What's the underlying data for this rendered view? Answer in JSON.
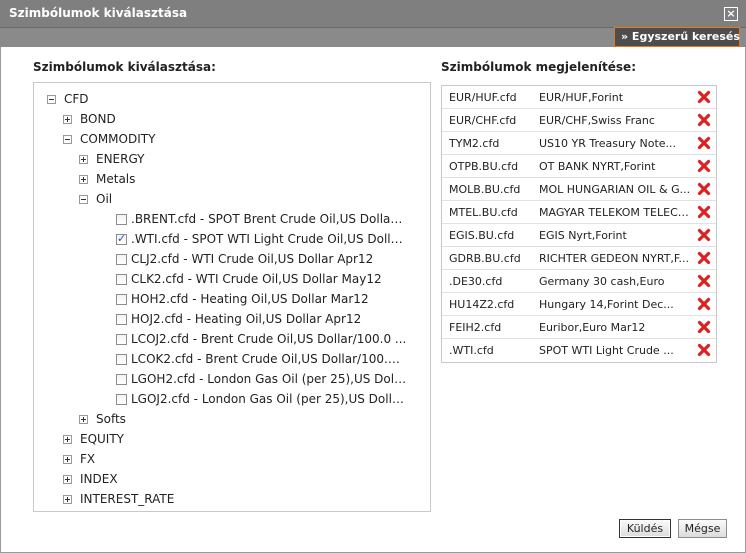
{
  "dialog": {
    "title": "Szimbólumok kiválasztása",
    "simple_search_label": "» Egyszerű keresés"
  },
  "left_heading": "Szimbólumok kiválasztása:",
  "right_heading": "Szimbólumok megjelenítése:",
  "tree": {
    "cfd": "CFD",
    "bond": "BOND",
    "commodity": "COMMODITY",
    "energy": "ENERGY",
    "metals": "Metals",
    "oil": "Oil",
    "softs": "Softs",
    "equity": "EQUITY",
    "fx": "FX",
    "index": "INDEX",
    "interest_rate": "INTEREST_RATE",
    "oil_items": [
      {
        "label": ".BRENT.cfd - SPOT Brent Crude Oil,US Dollar/...",
        "checked": false
      },
      {
        "label": ".WTI.cfd - SPOT WTI Light Crude Oil,US Dolla...",
        "checked": true
      },
      {
        "label": "CLJ2.cfd - WTI Crude Oil,US Dollar Apr12",
        "checked": false
      },
      {
        "label": "CLK2.cfd - WTI Crude Oil,US Dollar May12",
        "checked": false
      },
      {
        "label": "HOH2.cfd - Heating Oil,US Dollar Mar12",
        "checked": false
      },
      {
        "label": "HOJ2.cfd - Heating Oil,US Dollar Apr12",
        "checked": false
      },
      {
        "label": "LCOJ2.cfd - Brent Crude Oil,US Dollar/100.0 ...",
        "checked": false
      },
      {
        "label": "LCOK2.cfd - Brent Crude Oil,US Dollar/100.0 ...",
        "checked": false
      },
      {
        "label": "LGOH2.cfd - London Gas Oil (per 25),US Dolla...",
        "checked": false
      },
      {
        "label": "LGOJ2.cfd - London Gas Oil (per 25),US Dolla...",
        "checked": false
      }
    ]
  },
  "selected": [
    {
      "code": "EUR/HUF.cfd",
      "desc": "EUR/HUF,Forint"
    },
    {
      "code": "EUR/CHF.cfd",
      "desc": "EUR/CHF,Swiss Franc"
    },
    {
      "code": "TYM2.cfd",
      "desc": "US10 YR Treasury Note..."
    },
    {
      "code": "OTPB.BU.cfd",
      "desc": "OT BANK NYRT,Forint"
    },
    {
      "code": "MOLB.BU.cfd",
      "desc": "MOL HUNGARIAN OIL & G..."
    },
    {
      "code": "MTEL.BU.cfd",
      "desc": "MAGYAR TELEKOM TELECO..."
    },
    {
      "code": "EGIS.BU.cfd",
      "desc": "EGIS Nyrt,Forint"
    },
    {
      "code": "GDRB.BU.cfd",
      "desc": "RICHTER GEDEON NYRT,F..."
    },
    {
      "code": ".DE30.cfd",
      "desc": "Germany 30 cash,Euro"
    },
    {
      "code": "HU14Z2.cfd",
      "desc": "Hungary 14,Forint Dec..."
    },
    {
      "code": "FEIH2.cfd",
      "desc": "Euribor,Euro Mar12"
    },
    {
      "code": ".WTI.cfd",
      "desc": "SPOT WTI Light Crude ..."
    }
  ],
  "buttons": {
    "send": "Küldés",
    "cancel": "Mégse"
  },
  "colors": {
    "titlebar": "#7f7f7f",
    "accent": "#e07a1c",
    "delete": "#e02020"
  }
}
